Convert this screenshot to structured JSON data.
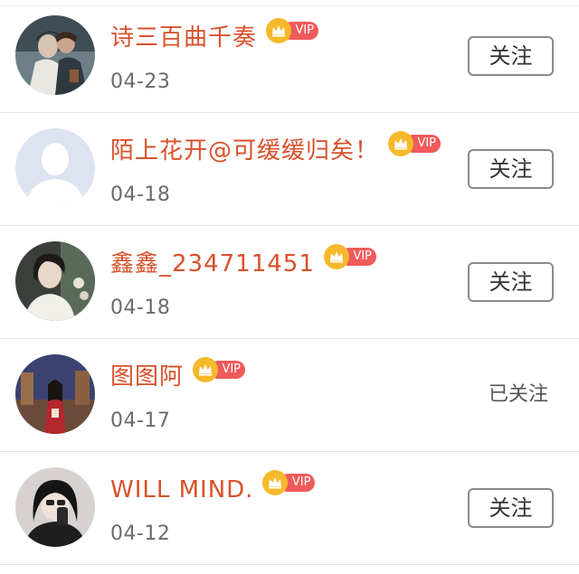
{
  "users": [
    {
      "name": "诗三百曲千奏",
      "date": "04-23",
      "badge": "VIP",
      "followed": false,
      "avatar_icon": "photo-avatar-couple"
    },
    {
      "name": "陌上花开@可缓缓归矣！",
      "date": "04-18",
      "badge": "VIP",
      "followed": false,
      "avatar_icon": "default-person-avatar"
    },
    {
      "name": "鑫鑫_234711451",
      "date": "04-18",
      "badge": "VIP",
      "followed": false,
      "avatar_icon": "photo-avatar-woman"
    },
    {
      "name": "图图阿",
      "date": "04-17",
      "badge": "VIP",
      "followed": true,
      "avatar_icon": "photo-avatar-game-character"
    },
    {
      "name": "WILL MIND.",
      "date": "04-12",
      "badge": "VIP",
      "followed": false,
      "avatar_icon": "photo-avatar-selfie"
    }
  ],
  "labels": {
    "follow": "关注",
    "followed": "已关注"
  },
  "colors": {
    "username": "#d9502a",
    "vip_tag": "#ef5a5a",
    "crown": "#f6b92b",
    "divider": "#e6e6e6"
  }
}
